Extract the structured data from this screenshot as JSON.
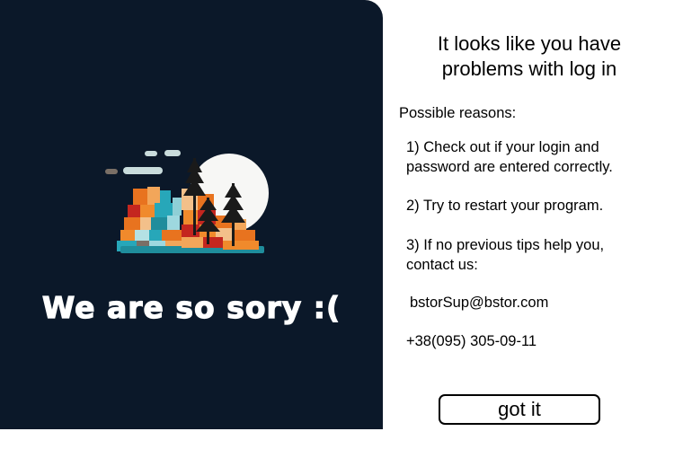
{
  "left_panel": {
    "apology_text": "We are so sory :(",
    "illustration_icon": "forest-landscape-illustration"
  },
  "right_panel": {
    "heading_line1": "It looks like you have",
    "heading_line2": "problems with log in",
    "reasons_label": "Possible reasons:",
    "tip1_line1": "1) Check out if your login and",
    "tip1_line2": "password are entered correctly.",
    "tip2": "2) Try to restart your program.",
    "tip3_line1": "3) If no previous tips help you,",
    "tip3_line2": "contact us:",
    "email": "bstorSup@bstor.com",
    "phone": "+38(095) 305-09-11",
    "button_label": "got it"
  },
  "colors": {
    "panel_background": "#0b1829",
    "orange": "#e8731f",
    "teal": "#27a7b9",
    "red": "#c4261f",
    "moon": "#f5f5f5"
  }
}
